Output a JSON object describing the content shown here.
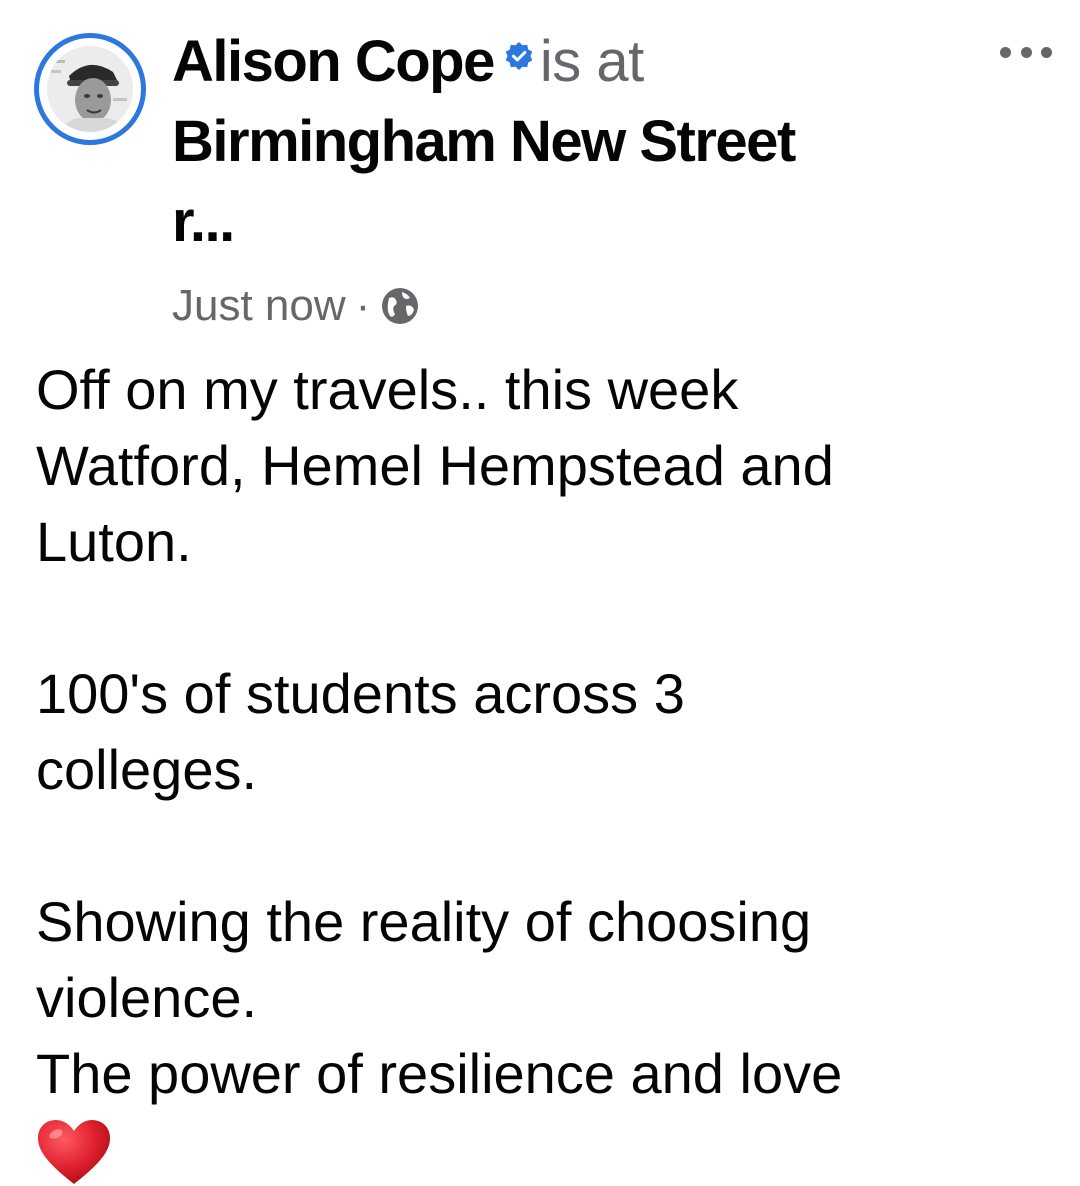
{
  "post": {
    "author": "Alison Cope",
    "verb": "is at",
    "location_line1": "Birmingham New Street",
    "location_line2": "r...",
    "timestamp": "Just now",
    "separator": "·",
    "privacy_icon": "globe-icon",
    "verified_icon": "verified-badge-icon",
    "more_icon": "more-options-icon",
    "body": {
      "p1_l1": "Off on my travels.. this week",
      "p1_l2": "Watford, Hemel Hempstead and",
      "p1_l3": "Luton.",
      "p2_l1": "100's of students across 3",
      "p2_l2": "colleges.",
      "p3_l1": "Showing the reality of choosing",
      "p3_l2": "violence.",
      "p3_l3": "The power of resilience and love",
      "emoji": "red-heart-icon"
    }
  },
  "colors": {
    "accent": "#2d78e0",
    "text_primary": "#050505",
    "text_secondary": "#65676b",
    "heart": "#e0202e"
  }
}
